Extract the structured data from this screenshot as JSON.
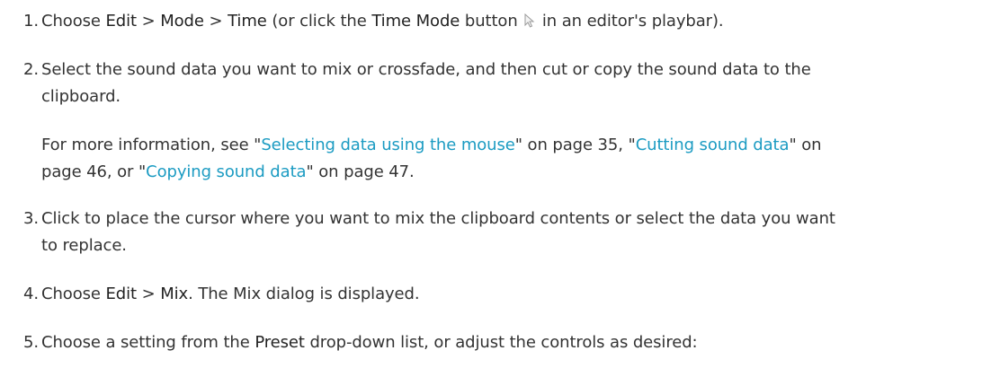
{
  "steps": [
    {
      "num": "1.",
      "t1": "Choose ",
      "m1": "Edit",
      "s1": " > ",
      "m2": "Mode",
      "s2": " > ",
      "m3": "Time",
      "t2": " (or click the ",
      "m4": "Time Mode",
      "t3": " button ",
      "icon": "arrow-cursor-icon",
      "t4": " in an editor's playbar)."
    },
    {
      "num": "2.",
      "line1": "Select the sound data you want to mix or crossfade, and then cut or copy the sound data to the",
      "line2": "clipboard."
    },
    {
      "note": {
        "a": "For more information, see \"",
        "link1": "Selecting data using the mouse",
        "b": "\" on page 35, \"",
        "link2": "Cutting sound data",
        "c": "\" on",
        "d": "page 46, or \"",
        "link3": "Copying sound data",
        "e": "\" on page 47."
      }
    },
    {
      "num": "3.",
      "line1": "Click to place the cursor where you want to mix the clipboard contents or select the data you want",
      "line2": "to replace."
    },
    {
      "num": "4.",
      "t1": "Choose ",
      "m1": "Edit",
      "s1": " > ",
      "m2": "Mix",
      "t2": ". The Mix dialog is displayed."
    },
    {
      "num": "5.",
      "t1": "Choose a setting from the ",
      "m1": "Preset",
      "t2": " drop-down list, or adjust the controls as desired:"
    }
  ],
  "colors": {
    "text": "#333333",
    "link": "#1b9bc2"
  }
}
